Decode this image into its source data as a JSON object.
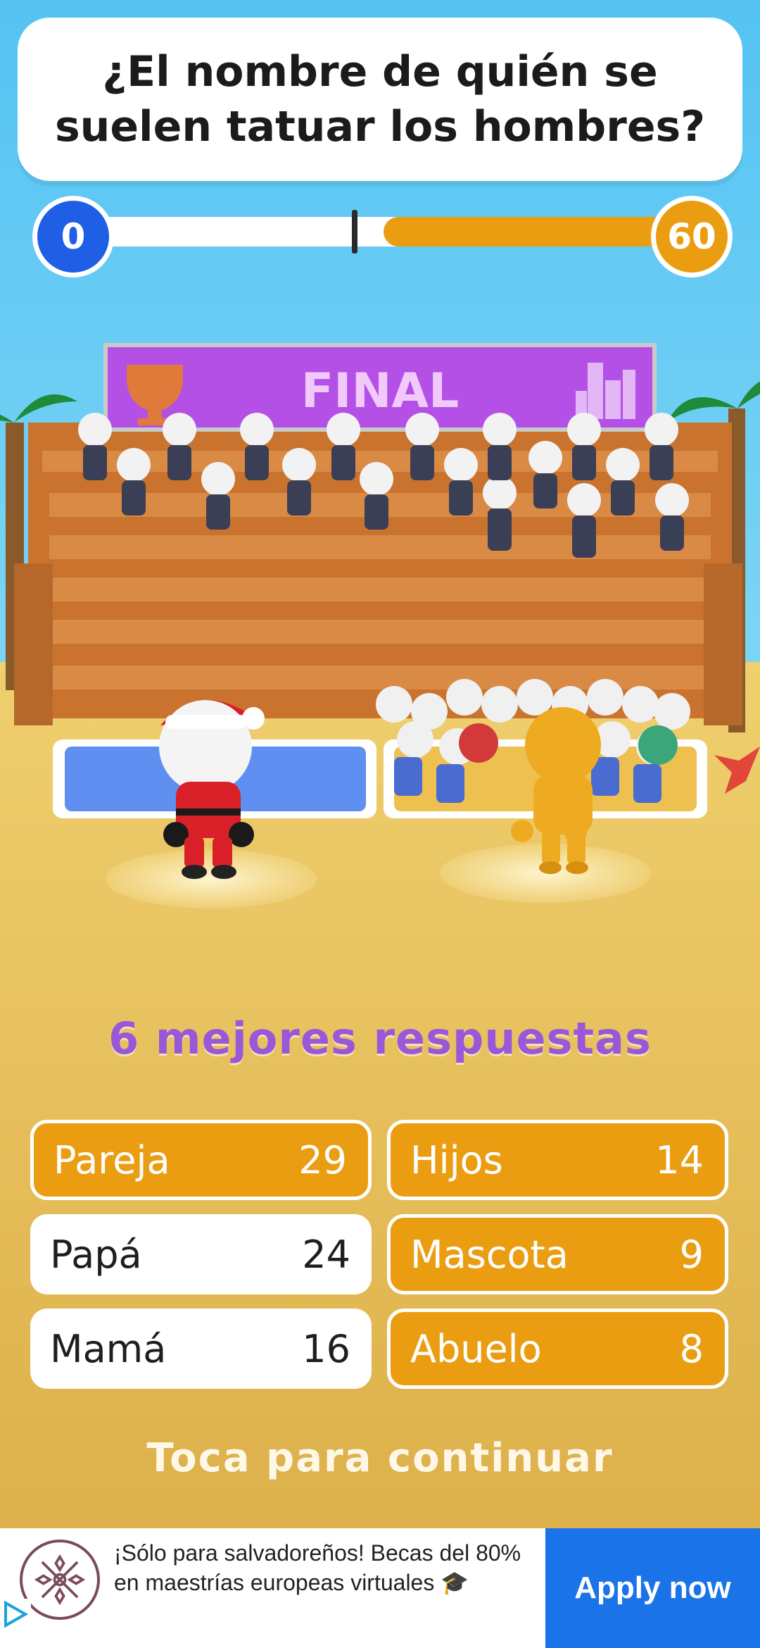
{
  "question": {
    "text": "¿El nombre de quién se suelen tatuar los hombres?"
  },
  "progress": {
    "left_score": "0",
    "right_score": "60",
    "fill_fraction": 0.5,
    "marker_fraction": 0.45
  },
  "stage": {
    "banner_text": "FINAL"
  },
  "results": {
    "heading": "6 mejores respuestas",
    "answers": [
      {
        "label": "Pareja",
        "points": "29",
        "revealed": true
      },
      {
        "label": "Hijos",
        "points": "14",
        "revealed": true
      },
      {
        "label": "Papá",
        "points": "24",
        "revealed": false
      },
      {
        "label": "Mascota",
        "points": "9",
        "revealed": true
      },
      {
        "label": "Mamá",
        "points": "16",
        "revealed": false
      },
      {
        "label": "Abuelo",
        "points": "8",
        "revealed": true
      }
    ],
    "continue_text": "Toca para continuar"
  },
  "ad": {
    "text": "¡Sólo para salvadoreños! Becas del 80% en maestrías europeas virtuales 🎓",
    "cta": "Apply now"
  },
  "colors": {
    "player_blue": "#1f5fe6",
    "answer_orange": "#eb9d12",
    "heading_purple": "#9a57d8",
    "banner_magenta": "#b450e6",
    "sky": "#5ec8f2",
    "sand": "#e2b84f",
    "ad_blue": "#1a73e8"
  }
}
